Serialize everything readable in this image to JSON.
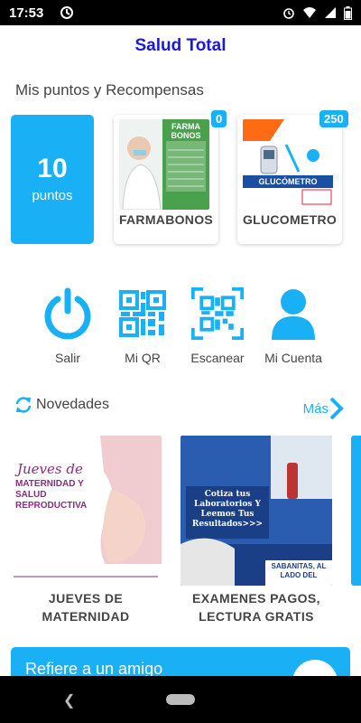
{
  "status_bar": {
    "time": "17:53",
    "icons": [
      "sync-icon",
      "alarm-icon",
      "wifi-icon",
      "signal-icon",
      "battery-icon"
    ]
  },
  "app": {
    "title": "Salud Total"
  },
  "rewards": {
    "section_title": "Mis puntos y Recompensas",
    "points": {
      "value": "10",
      "label": "puntos"
    },
    "items": [
      {
        "name": "FARMABONOS",
        "points": "0",
        "image_text": "FARMA BONOS"
      },
      {
        "name": "GLUCOMETRO",
        "points": "250",
        "image_text": "GLUCÓMETRO"
      }
    ]
  },
  "actions": [
    {
      "label": "Salir",
      "icon": "power-icon"
    },
    {
      "label": "Mi QR",
      "icon": "qr-code-icon"
    },
    {
      "label": "Escanear",
      "icon": "qr-scan-icon"
    },
    {
      "label": "Mi Cuenta",
      "icon": "user-icon"
    }
  ],
  "news": {
    "title": "Novedades",
    "more_label": "Más",
    "items": [
      {
        "title_line1": "JUEVES DE",
        "title_line2": "MATERNIDAD",
        "image_text1": "Jueves de",
        "image_text2": "MATERNIDAD Y SALUD REPRODUCTIVA"
      },
      {
        "title_line1": "EXAMENES PAGOS,",
        "title_line2": "LECTURA GRATIS",
        "image_text1": "Cotiza tus Laboratorios Y Leemos Tus Resultados>>>",
        "image_text2": "SABANITAS, AL LADO DEL"
      }
    ]
  },
  "refer": {
    "label": "Refiere a un amigo"
  },
  "colors": {
    "accent": "#1ab0f5",
    "title": "#1a1ad6",
    "text": "#444444"
  }
}
